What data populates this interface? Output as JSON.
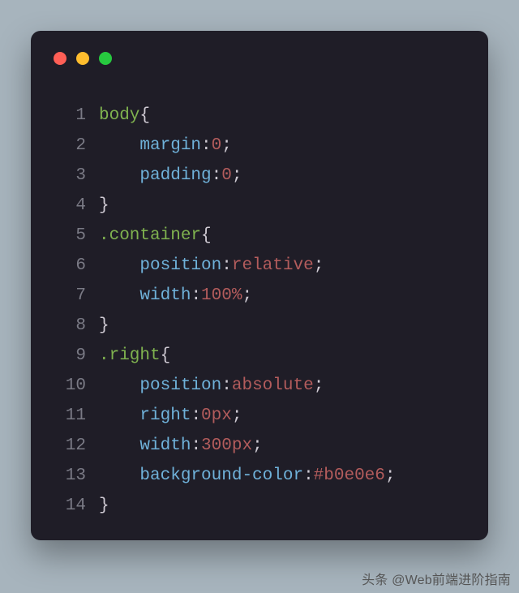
{
  "watermark": "头条 @Web前端进阶指南",
  "code": {
    "indent": "    ",
    "lines": [
      {
        "num": "1",
        "kind": "rule_open",
        "selector": "body"
      },
      {
        "num": "2",
        "kind": "decl",
        "prop": "margin",
        "value": "0"
      },
      {
        "num": "3",
        "kind": "decl",
        "prop": "padding",
        "value": "0"
      },
      {
        "num": "4",
        "kind": "rule_close"
      },
      {
        "num": "5",
        "kind": "rule_open",
        "selector": ".container"
      },
      {
        "num": "6",
        "kind": "decl",
        "prop": "position",
        "value": "relative"
      },
      {
        "num": "7",
        "kind": "decl",
        "prop": "width",
        "value": "100%"
      },
      {
        "num": "8",
        "kind": "rule_close"
      },
      {
        "num": "9",
        "kind": "rule_open",
        "selector": ".right"
      },
      {
        "num": "10",
        "kind": "decl",
        "prop": "position",
        "value": "absolute"
      },
      {
        "num": "11",
        "kind": "decl",
        "prop": "right",
        "value": "0px"
      },
      {
        "num": "12",
        "kind": "decl",
        "prop": "width",
        "value": "300px"
      },
      {
        "num": "13",
        "kind": "decl",
        "prop": "background-color",
        "value": "#b0e0e6"
      },
      {
        "num": "14",
        "kind": "rule_close"
      }
    ]
  }
}
